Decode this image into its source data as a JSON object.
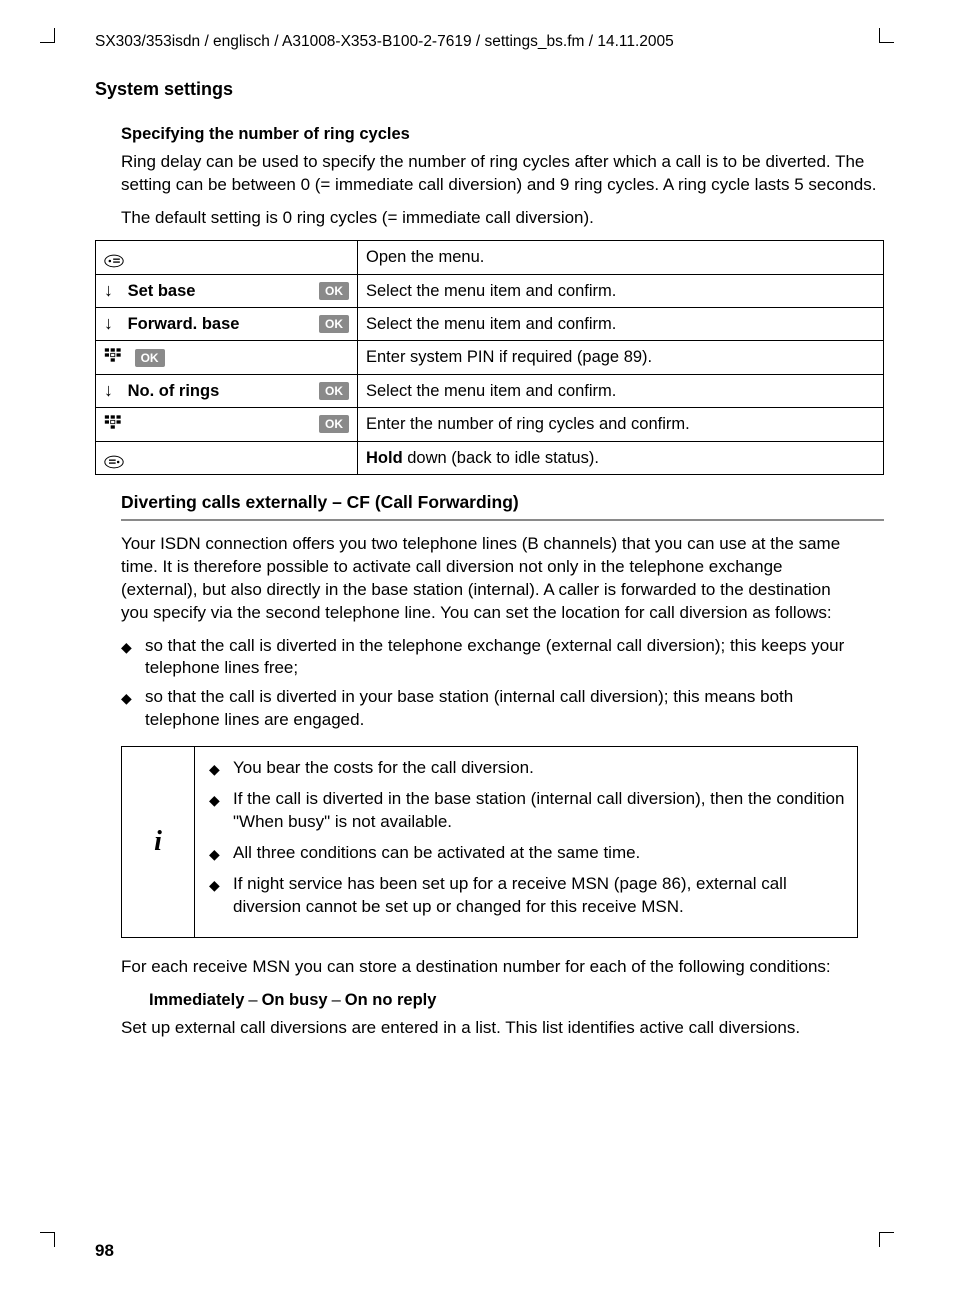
{
  "header_path": "SX303/353isdn / englisch / A31008-X353-B100-2-7619 / settings_bs.fm / 14.11.2005",
  "section_title": "System settings",
  "ring": {
    "title": "Specifying the number of ring cycles",
    "p1": "Ring delay can be used to specify the number of ring cycles after which a call is to be diverted. The setting can be between 0 (= immediate call diversion) and 9 ring cycles. A ring cycle lasts 5 seconds.",
    "p2": "The default setting is 0 ring cycles (= immediate call diversion)."
  },
  "ok_label": "OK",
  "steps": [
    {
      "icon": "menu",
      "label": "",
      "ok": false,
      "desc": "Open the menu."
    },
    {
      "icon": "down",
      "label": "Set base",
      "ok": true,
      "desc": "Select the menu item and confirm."
    },
    {
      "icon": "down",
      "label": "Forward. base",
      "ok": true,
      "desc": "Select the menu item and confirm."
    },
    {
      "icon": "keypad",
      "label_ok_inline": true,
      "ok": true,
      "desc": "Enter system PIN if required (page 89)."
    },
    {
      "icon": "down",
      "label": "No. of rings",
      "ok": true,
      "desc": "Select the menu item and confirm."
    },
    {
      "icon": "keypad",
      "label": "",
      "ok": true,
      "desc": "Enter the number of ring cycles and confirm."
    },
    {
      "icon": "menu",
      "label": "",
      "ok": false,
      "desc_bold": "Hold",
      "desc": " down (back to idle status)."
    }
  ],
  "cf": {
    "title": "Diverting calls externally – CF (Call Forwarding)",
    "intro": "Your ISDN connection offers you two telephone lines (B channels) that you can use at the same time. It is therefore possible to activate call diversion not only in the telephone exchange (external), but also directly in the base station (internal). A caller is forwarded to the destination you specify via the second telephone line. You can set the location for call diversion as follows:",
    "bullets": [
      "so that the call is diverted in the telephone exchange (external call diversion); this keeps your telephone lines free;",
      "so that the call is diverted in your base station (internal call diversion); this means both telephone lines are engaged."
    ],
    "note": [
      "You bear the costs for the call diversion.",
      "If the call is diverted in the base station (internal call diversion), then the condition \"When busy\" is not available.",
      "All three conditions can be activated at the same time.",
      "If night service has been set up for a receive MSN (page 86), external call diversion cannot be set up or changed for this receive MSN."
    ],
    "after_note": "For each receive MSN you can store a destination number for each of the following conditions:",
    "conditions": [
      "Immediately",
      "On busy",
      "On no reply"
    ],
    "tail": "Set up external call diversions are entered in a list. This list identifies active call diversions."
  },
  "page_number": "98"
}
